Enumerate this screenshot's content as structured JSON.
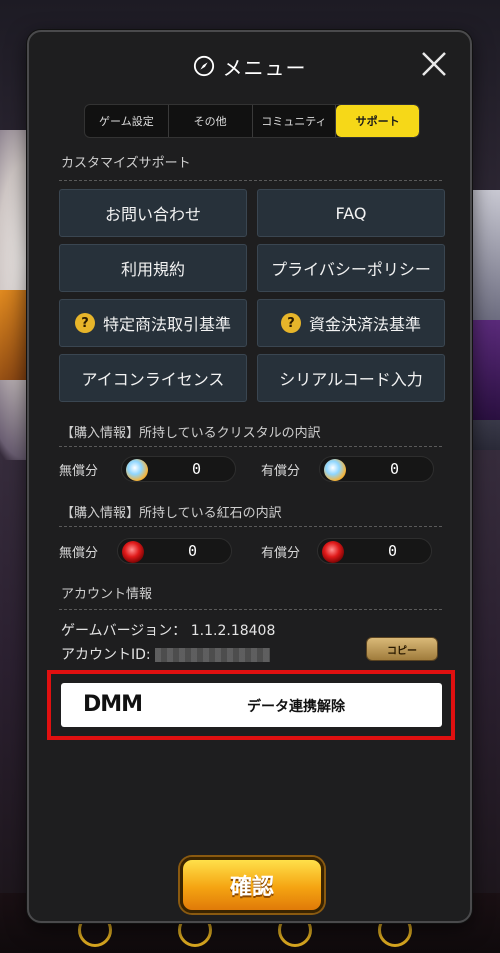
{
  "header": {
    "title": "メニュー",
    "icon": "compass-icon"
  },
  "tabs": [
    {
      "label": "ゲーム設定",
      "active": false
    },
    {
      "label": "その他",
      "active": false
    },
    {
      "label": "コミュニティ",
      "active": false
    },
    {
      "label": "サポート",
      "active": true
    }
  ],
  "support": {
    "section_title": "カスタマイズサポート",
    "buttons": [
      {
        "label": "お問い合わせ",
        "icon": ""
      },
      {
        "label": "FAQ",
        "icon": ""
      },
      {
        "label": "利用規約",
        "icon": ""
      },
      {
        "label": "プライバシーポリシー",
        "icon": ""
      },
      {
        "label": "特定商法取引基準",
        "icon": "question-icon"
      },
      {
        "label": "資金決済法基準",
        "icon": "question-icon"
      },
      {
        "label": "アイコンライセンス",
        "icon": ""
      },
      {
        "label": "シリアルコード入力",
        "icon": ""
      }
    ]
  },
  "crystal": {
    "section_title": "【購入情報】所持しているクリスタルの内訳",
    "free_label": "無償分",
    "free_value": "0",
    "paid_label": "有償分",
    "paid_value": "0"
  },
  "ruby": {
    "section_title": "【購入情報】所持している紅石の内訳",
    "free_label": "無償分",
    "free_value": "0",
    "paid_label": "有償分",
    "paid_value": "0"
  },
  "account": {
    "section_title": "アカウント情報",
    "version_label": "ゲームバージョン：",
    "version_value": "1.1.2.18408",
    "id_label": "アカウントID:",
    "copy_label": "コピー"
  },
  "dmm": {
    "logo": "DMM",
    "label": "データ連携解除"
  },
  "confirm_label": "確認",
  "colors": {
    "accent_tab": "#f6d818",
    "highlight_outline": "#e01010",
    "button_bg": "#27313a",
    "confirm_gradient_top": "#ffe04a"
  }
}
